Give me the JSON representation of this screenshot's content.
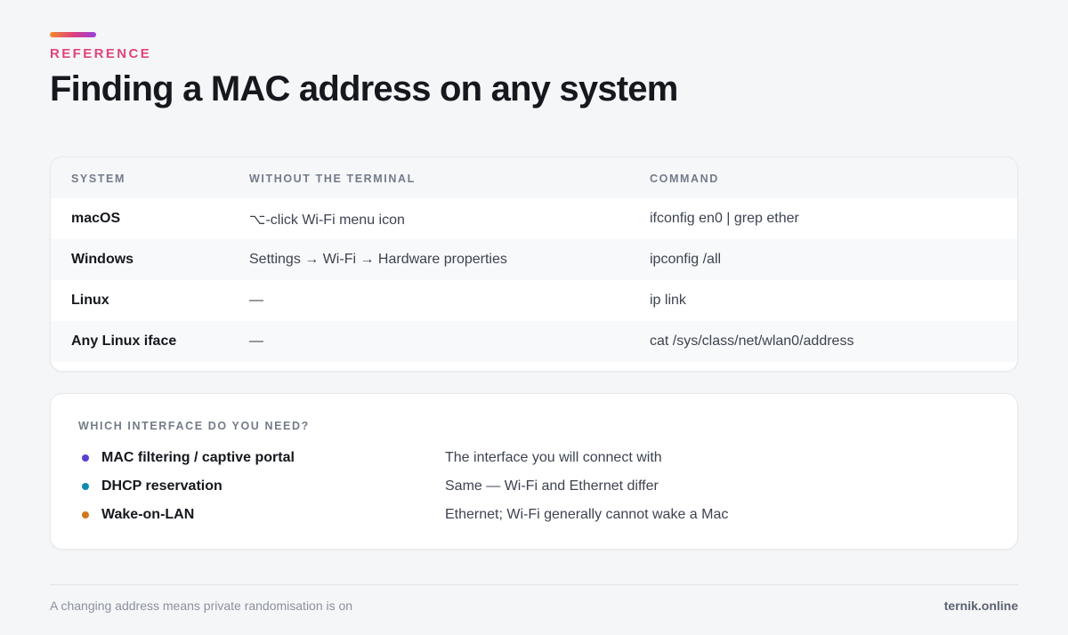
{
  "header": {
    "eyebrow": "REFERENCE",
    "title": "Finding a MAC address on any system"
  },
  "table": {
    "columns": [
      "SYSTEM",
      "WITHOUT THE TERMINAL",
      "COMMAND"
    ],
    "rows": [
      {
        "system": "macOS",
        "gui": "⌥-click Wi-Fi menu icon",
        "command": "ifconfig en0 | grep ether"
      },
      {
        "system": "Windows",
        "gui": "Settings → Wi-Fi → Hardware properties",
        "command": "ipconfig /all"
      },
      {
        "system": "Linux",
        "gui": "—",
        "command": "ip link"
      },
      {
        "system": "Any Linux iface",
        "gui": "—",
        "command": "cat /sys/class/net/wlan0/address"
      }
    ]
  },
  "legend": {
    "title": "WHICH INTERFACE DO YOU NEED?",
    "items": [
      {
        "label": "MAC filtering / captive portal",
        "desc": "The interface you will connect with",
        "color": "#5b3fd0"
      },
      {
        "label": "DHCP reservation",
        "desc": "Same — Wi-Fi and Ethernet differ",
        "color": "#0f8ab0"
      },
      {
        "label": "Wake-on-LAN",
        "desc": "Ethernet; Wi-Fi generally cannot wake a Mac",
        "color": "#d0791a"
      }
    ]
  },
  "footer": {
    "note": "A changing address means private randomisation is on",
    "brand": "ternik.online"
  }
}
